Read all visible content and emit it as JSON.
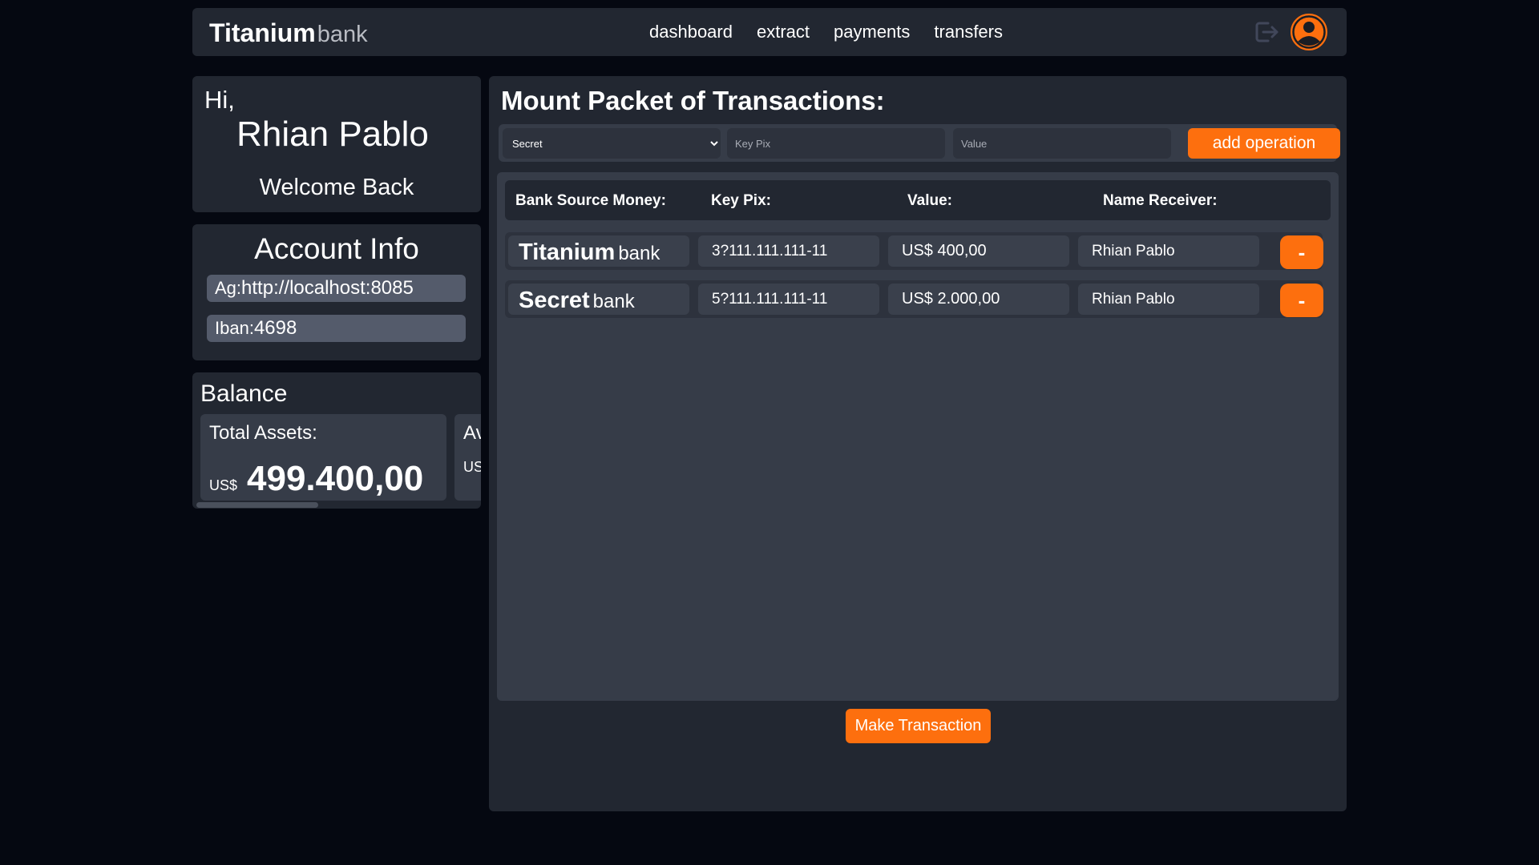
{
  "header": {
    "brand_strong": "Titanium",
    "brand_light": "bank",
    "nav": [
      "dashboard",
      "extract",
      "payments",
      "transfers"
    ],
    "icons": {
      "logout": "logout-icon",
      "profile": "user-avatar-icon"
    },
    "accent_color": "#fd6f0e"
  },
  "greeting": {
    "hi": "Hi,",
    "name": "Rhian Pablo",
    "welcome": "Welcome Back"
  },
  "account": {
    "title": "Account Info",
    "ag_prefix": "Ag:",
    "ag_value": "http://localhost:8085",
    "iban_prefix": "Iban:",
    "iban_value": "4698"
  },
  "balance": {
    "title": "Balance",
    "total_label": "Total Assets:",
    "total_currency": "US$",
    "total_value": "499.400,00",
    "available_label": "Av",
    "available_currency": "US"
  },
  "main": {
    "title": "Mount Packet of Transactions:",
    "select_value": "Secret",
    "key_placeholder": "Key Pix",
    "value_placeholder": "Value",
    "add_button": "add operation",
    "columns": [
      "Bank Source Money:",
      "Key Pix:",
      "Value:",
      "Name Receiver:"
    ],
    "rows": [
      {
        "bank_strong": "Titanium",
        "bank_light": "bank",
        "key": "3?111.111.111-11",
        "value": "US$ 400,00",
        "receiver": "Rhian Pablo",
        "remove": "-"
      },
      {
        "bank_strong": "Secret",
        "bank_light": "bank",
        "key": "5?111.111.111-11",
        "value": "US$ 2.000,00",
        "receiver": "Rhian Pablo",
        "remove": "-"
      }
    ],
    "make_button": "Make Transaction"
  }
}
